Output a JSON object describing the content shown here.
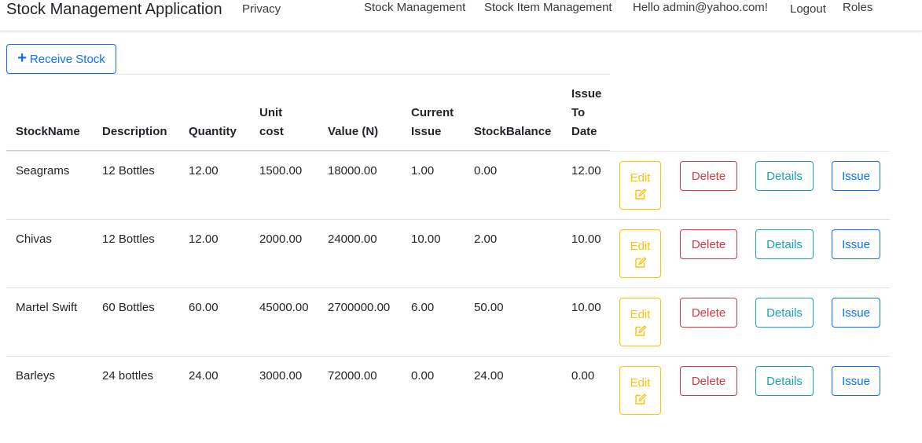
{
  "navbar": {
    "brand": "Stock Management Application",
    "privacy": "Privacy",
    "stock_management": "Stock Management",
    "stock_item_management": "Stock Item Management",
    "greeting": "Hello admin@yahoo.com!",
    "logout": "Logout",
    "roles": "Roles"
  },
  "receive_button": {
    "icon": "plus-icon",
    "label": "Receive Stock"
  },
  "table": {
    "headers": {
      "stockname": "StockName",
      "description": "Description",
      "quantity": "Quantity",
      "unitcost_1": "Unit",
      "unitcost_2": "cost",
      "value": "Value (N)",
      "current_1": "Current",
      "current_2": "Issue",
      "balance": "StockBalance",
      "issue_1": "Issue",
      "issue_2": "To",
      "issue_3": "Date"
    },
    "rows": [
      {
        "name": "Seagrams",
        "description": "12 Bottles",
        "quantity": "12.00",
        "unit_cost": "1500.00",
        "value": "18000.00",
        "current_issue": "1.00",
        "balance": "0.00",
        "issue_to_date": "12.00"
      },
      {
        "name": "Chivas",
        "description": "12 Bottles",
        "quantity": "12.00",
        "unit_cost": "2000.00",
        "value": "24000.00",
        "current_issue": "10.00",
        "balance": "2.00",
        "issue_to_date": "10.00"
      },
      {
        "name": "Martel Swift",
        "description": "60 Bottles",
        "quantity": "60.00",
        "unit_cost": "45000.00",
        "value": "2700000.00",
        "current_issue": "6.00",
        "balance": "50.00",
        "issue_to_date": "10.00"
      },
      {
        "name": "Barleys",
        "description": "24 bottles",
        "quantity": "24.00",
        "unit_cost": "3000.00",
        "value": "72000.00",
        "current_issue": "0.00",
        "balance": "24.00",
        "issue_to_date": "0.00"
      }
    ]
  },
  "actions": {
    "edit": "Edit",
    "delete": "Delete",
    "details": "Details",
    "issue": "Issue"
  },
  "colors": {
    "primary": "#0d6efd",
    "warning": "#ffc107",
    "danger": "#dc3545",
    "info": "#17a2b8"
  }
}
